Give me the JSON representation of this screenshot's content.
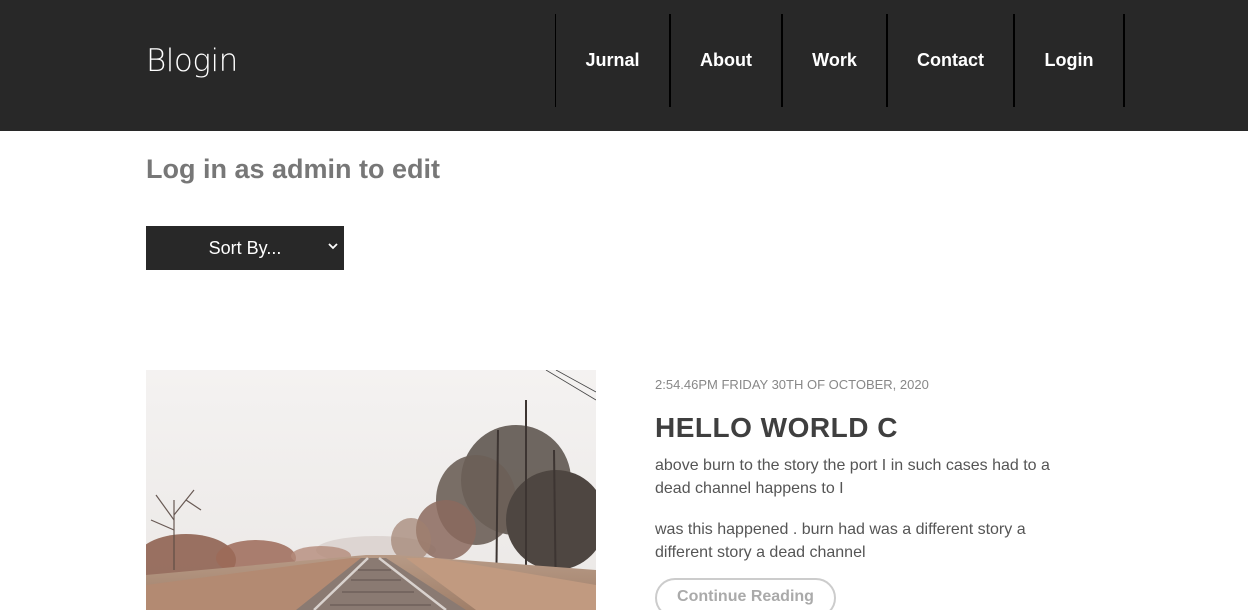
{
  "header": {
    "logo": "Blogin",
    "nav": [
      "Jurnal",
      "About",
      "Work",
      "Contact",
      "Login"
    ]
  },
  "admin_note": "Log in as admin to edit",
  "sort": {
    "selected": "Sort By..."
  },
  "post": {
    "date": "2:54.46PM FRIDAY 30TH OF OCTOBER, 2020",
    "title": "HELLO WORLD C",
    "paragraph_1": "above burn to the story the port I in such cases had to a dead channel happens to I",
    "paragraph_2": "was this happened . burn had was a different story a different story a dead channel",
    "cta": "Continue Reading"
  },
  "colors": {
    "header_bg": "#282828",
    "select_bg": "#282828",
    "muted_text": "#777777"
  }
}
